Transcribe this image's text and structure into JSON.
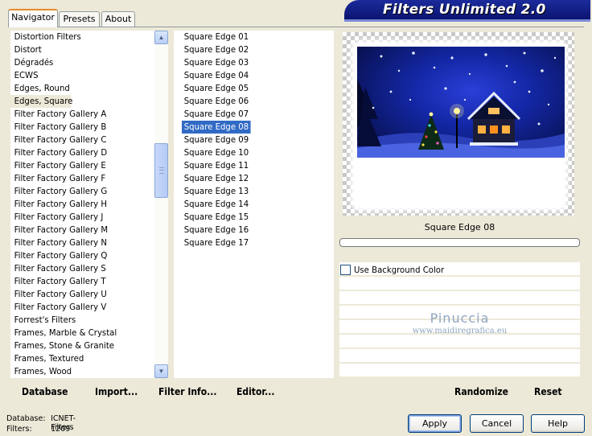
{
  "app": {
    "title": "Filters Unlimited 2.0"
  },
  "tabs": [
    {
      "label": "Navigator",
      "active": true
    },
    {
      "label": "Presets",
      "active": false
    },
    {
      "label": "About",
      "active": false
    }
  ],
  "categories": {
    "selected": "Edges, Square",
    "items": [
      "Distortion Filters",
      "Distort",
      "Dégradés",
      "ECWS",
      "Edges, Round",
      "Edges, Square",
      "Filter Factory Gallery A",
      "Filter Factory Gallery B",
      "Filter Factory Gallery C",
      "Filter Factory Gallery D",
      "Filter Factory Gallery E",
      "Filter Factory Gallery F",
      "Filter Factory Gallery G",
      "Filter Factory Gallery H",
      "Filter Factory Gallery J",
      "Filter Factory Gallery M",
      "Filter Factory Gallery N",
      "Filter Factory Gallery Q",
      "Filter Factory Gallery S",
      "Filter Factory Gallery T",
      "Filter Factory Gallery U",
      "Filter Factory Gallery V",
      "Forrest's Filters",
      "Frames, Marble & Crystal",
      "Frames, Stone & Granite",
      "Frames, Textured",
      "Frames, Wood"
    ]
  },
  "filters": {
    "selected": "Square Edge 08",
    "items": [
      "Square Edge 01",
      "Square Edge 02",
      "Square Edge 03",
      "Square Edge 04",
      "Square Edge 05",
      "Square Edge 06",
      "Square Edge 07",
      "Square Edge 08",
      "Square Edge 09",
      "Square Edge 10",
      "Square Edge 11",
      "Square Edge 12",
      "Square Edge 13",
      "Square Edge 14",
      "Square Edge 15",
      "Square Edge 16",
      "Square Edge 17"
    ]
  },
  "preview": {
    "filter_name": "Square Edge 08",
    "progress": 0,
    "use_background_color_label": "Use Background Color",
    "use_background_color_checked": false,
    "watermark_line1": "Pinuccia",
    "watermark_line2": "www.maidiregrafica.eu"
  },
  "toolbar": {
    "database": "Database",
    "import": "Import...",
    "filter_info": "Filter Info...",
    "editor": "Editor...",
    "randomize": "Randomize",
    "reset": "Reset"
  },
  "status": {
    "database_label": "Database:",
    "database_value": "ICNET-Filters",
    "filters_label": "Filters:",
    "filters_value": "1209"
  },
  "buttons": {
    "apply": "Apply",
    "cancel": "Cancel",
    "help": "Help"
  },
  "colors": {
    "banner": "#0a1470",
    "selection": "#316ac5",
    "tab_accent": "#e68b2c"
  }
}
